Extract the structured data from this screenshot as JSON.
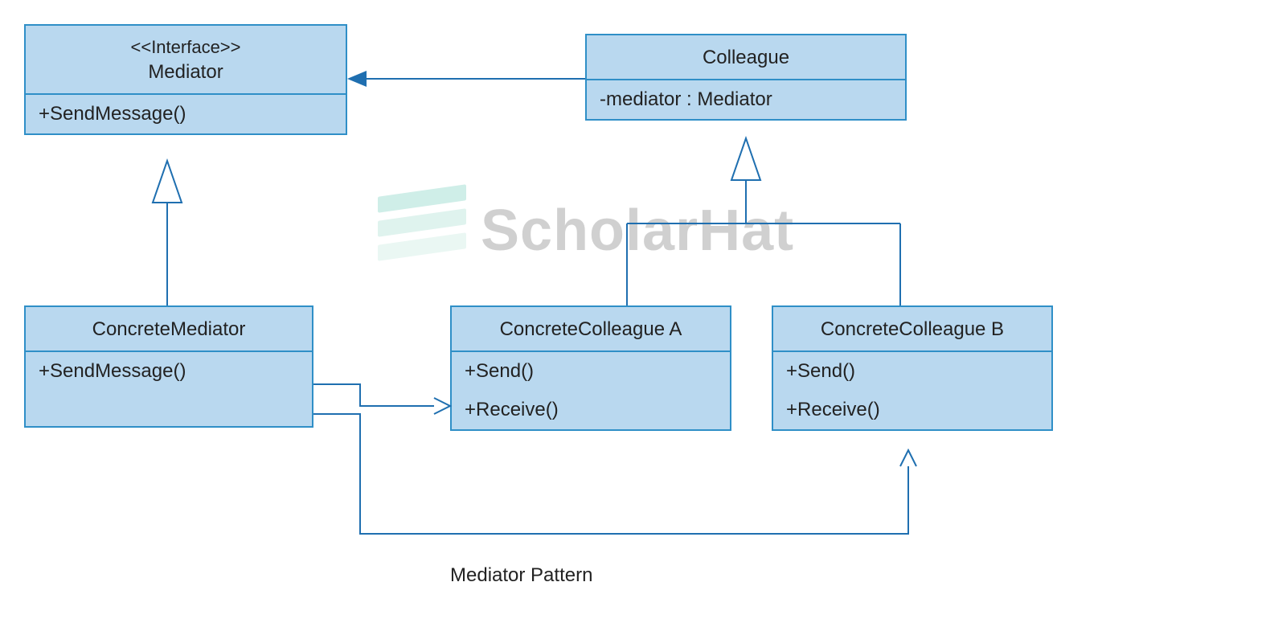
{
  "diagram": {
    "caption": "Mediator Pattern",
    "watermark_text": "ScholarHat",
    "boxes": {
      "mediator": {
        "stereotype": "<<Interface>>",
        "name": "Mediator",
        "members": [
          "+SendMessage()"
        ]
      },
      "colleague": {
        "name": "Colleague",
        "members": [
          "-mediator : Mediator"
        ]
      },
      "concreteMediator": {
        "name": "ConcreteMediator",
        "members": [
          "+SendMessage()"
        ]
      },
      "concreteColleagueA": {
        "name": "ConcreteColleague A",
        "members": [
          "+Send()",
          "+Receive()"
        ]
      },
      "concreteColleagueB": {
        "name": "ConcreteColleague B",
        "members": [
          "+Send()",
          "+Receive()"
        ]
      }
    },
    "edges": [
      {
        "from": "ConcreteMediator",
        "to": "Mediator",
        "type": "realization"
      },
      {
        "from": "Colleague",
        "to": "Mediator",
        "type": "association"
      },
      {
        "from": "ConcreteColleague A",
        "to": "Colleague",
        "type": "generalization"
      },
      {
        "from": "ConcreteColleague B",
        "to": "Colleague",
        "type": "generalization"
      },
      {
        "from": "ConcreteMediator",
        "to": "ConcreteColleague A",
        "type": "association"
      },
      {
        "from": "ConcreteMediator",
        "to": "ConcreteColleague B",
        "type": "association"
      }
    ]
  }
}
